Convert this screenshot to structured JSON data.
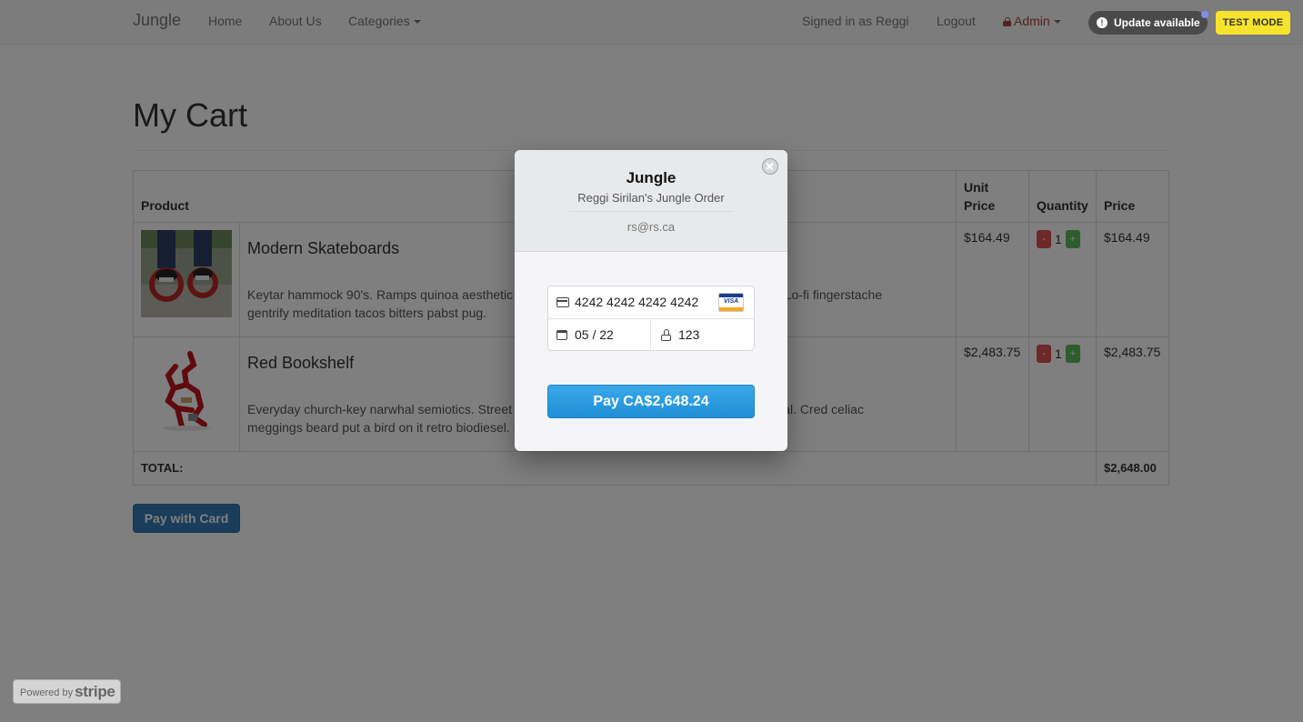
{
  "navbar": {
    "brand": "Jungle",
    "links": [
      "Home",
      "About Us"
    ],
    "categories": "Categories",
    "signed_in": "Signed in as Reggi",
    "logout": "Logout",
    "admin": "Admin",
    "update": "Update available",
    "test_mode": "TEST MODE"
  },
  "page": {
    "title": "My Cart"
  },
  "cart": {
    "headers": {
      "product": "Product",
      "unit_price": "Unit Price",
      "quantity": "Quantity",
      "price": "Price"
    },
    "items": [
      {
        "name": "Modern Skateboards",
        "description": "Keytar hammock 90's. Ramps quinoa aesthetic",
        "description_tail": "terest. Lo-fi fingerstache",
        "description_line2": "gentrify meditation tacos bitters pabst pug.",
        "unit_price": "$164.49",
        "quantity": "1",
        "price": "$164.49",
        "image_icon": "skateboard-image"
      },
      {
        "name": "Red Bookshelf",
        "description": "Everyday church-key narwhal semiotics. Street",
        "description_tail": "s ethical. Cred celiac",
        "description_line2": "meggings beard put a bird on it retro biodiesel. I",
        "unit_price": "$2,483.75",
        "quantity": "1",
        "price": "$2,483.75",
        "image_icon": "bookshelf-image"
      }
    ],
    "qty_minus": "-",
    "qty_plus": "+",
    "total_label": "TOTAL:",
    "total_value": "$2,648.00"
  },
  "pay_with_card": "Pay with Card",
  "checkout": {
    "title": "Jungle",
    "subtitle": "Reggi Sirilan's Jungle Order",
    "email": "rs@rs.ca",
    "card_number": "4242 4242 4242 4242",
    "card_brand": "VISA",
    "expiry": "05 / 22",
    "cvc": "123",
    "pay_button": "Pay CA$2,648.24"
  },
  "powered_by": {
    "prefix": "Powered by",
    "brand": "stripe"
  },
  "colors": {
    "primary": "#337ab7",
    "danger": "#d9534f",
    "success": "#5cb85c",
    "test_mode": "#f6e32c",
    "stripe_blue": "#2a9ae0"
  }
}
